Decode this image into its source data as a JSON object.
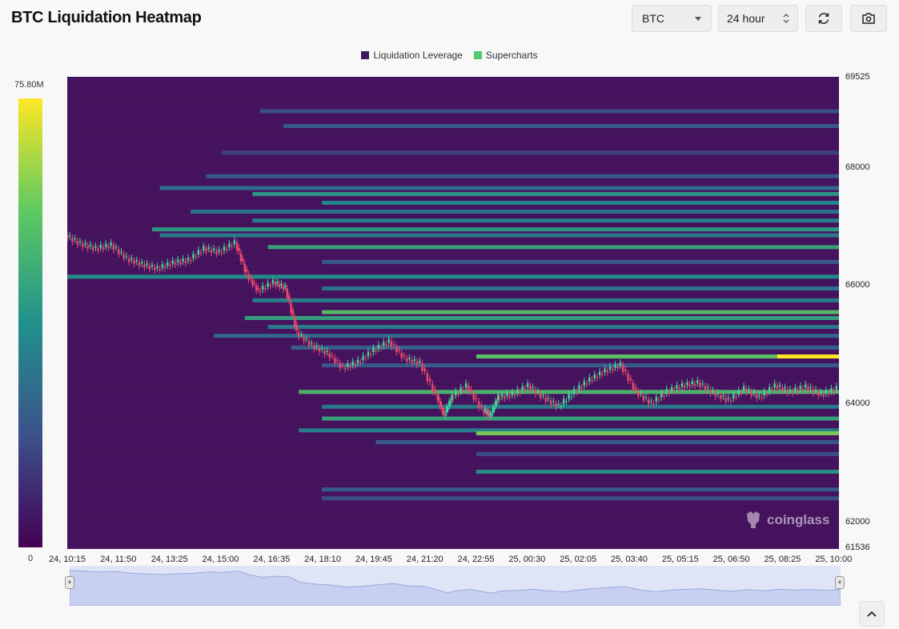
{
  "header": {
    "title": "BTC Liquidation Heatmap",
    "symbol": "BTC",
    "timeframe": "24 hour",
    "refresh_icon": "refresh-icon",
    "camera_icon": "camera-icon"
  },
  "legend": [
    {
      "label": "Liquidation Leverage",
      "color": "#3b1a5e"
    },
    {
      "label": "Supercharts",
      "color": "#4ecb71"
    }
  ],
  "colorbar": {
    "max_label": "75.80M",
    "min_label": "0"
  },
  "watermark": "coinglass",
  "chart_data": {
    "type": "heatmap",
    "title": "BTC Liquidation Heatmap",
    "ylim": [
      61536,
      69525
    ],
    "yticks": [
      "69525",
      "68000",
      "66000",
      "64000",
      "62000",
      "61536"
    ],
    "yticks_values": [
      69525,
      68000,
      66000,
      64000,
      62000,
      61536
    ],
    "xticks": [
      "24, 10:15",
      "24, 11:50",
      "24, 13:25",
      "24, 15:00",
      "24, 16:35",
      "24, 18:10",
      "24, 19:45",
      "24, 21:20",
      "24, 22:55",
      "25, 00:30",
      "25, 02:05",
      "25, 03:40",
      "25, 05:15",
      "25, 06:50",
      "25, 08:25",
      "25, 10:00"
    ],
    "colorscale": {
      "min": 0,
      "max": 75800000,
      "max_label": "75.80M"
    },
    "bands": [
      {
        "price": 68950,
        "start": 0.25,
        "value": 0.25
      },
      {
        "price": 68700,
        "start": 0.28,
        "value": 0.3
      },
      {
        "price": 68250,
        "start": 0.2,
        "value": 0.2
      },
      {
        "price": 67850,
        "start": 0.18,
        "value": 0.3
      },
      {
        "price": 67650,
        "start": 0.12,
        "value": 0.38
      },
      {
        "price": 67550,
        "start": 0.24,
        "value": 0.55
      },
      {
        "price": 67400,
        "start": 0.33,
        "value": 0.48
      },
      {
        "price": 67250,
        "start": 0.16,
        "value": 0.4
      },
      {
        "price": 67100,
        "start": 0.24,
        "value": 0.45
      },
      {
        "price": 66950,
        "start": 0.11,
        "value": 0.55
      },
      {
        "price": 66850,
        "start": 0.12,
        "value": 0.42
      },
      {
        "price": 66650,
        "start": 0.26,
        "value": 0.6
      },
      {
        "price": 66400,
        "start": 0.33,
        "value": 0.3
      },
      {
        "price": 66150,
        "start": 0.0,
        "value": 0.5
      },
      {
        "price": 65950,
        "start": 0.33,
        "value": 0.4
      },
      {
        "price": 65750,
        "start": 0.24,
        "value": 0.45
      },
      {
        "price": 65550,
        "start": 0.33,
        "value": 0.72
      },
      {
        "price": 65450,
        "start": 0.23,
        "value": 0.58
      },
      {
        "price": 65300,
        "start": 0.26,
        "value": 0.42
      },
      {
        "price": 65150,
        "start": 0.19,
        "value": 0.35
      },
      {
        "price": 64950,
        "start": 0.29,
        "value": 0.32
      },
      {
        "price": 64800,
        "start": 0.53,
        "value": 0.75,
        "hot_from": 0.92
      },
      {
        "price": 64650,
        "start": 0.33,
        "value": 0.3
      },
      {
        "price": 64200,
        "start": 0.3,
        "value": 0.68
      },
      {
        "price": 63950,
        "start": 0.33,
        "value": 0.42
      },
      {
        "price": 63750,
        "start": 0.33,
        "value": 0.6
      },
      {
        "price": 63550,
        "start": 0.3,
        "value": 0.45
      },
      {
        "price": 63500,
        "start": 0.53,
        "value": 0.8
      },
      {
        "price": 63350,
        "start": 0.4,
        "value": 0.3
      },
      {
        "price": 63150,
        "start": 0.53,
        "value": 0.25
      },
      {
        "price": 62850,
        "start": 0.53,
        "value": 0.52
      },
      {
        "price": 62550,
        "start": 0.33,
        "value": 0.3
      },
      {
        "price": 62400,
        "start": 0.33,
        "value": 0.25
      }
    ],
    "price_series": [
      [
        0,
        66850
      ],
      [
        0.02,
        66700
      ],
      [
        0.04,
        66620
      ],
      [
        0.06,
        66680
      ],
      [
        0.08,
        66450
      ],
      [
        0.1,
        66350
      ],
      [
        0.12,
        66280
      ],
      [
        0.14,
        66380
      ],
      [
        0.16,
        66420
      ],
      [
        0.18,
        66620
      ],
      [
        0.2,
        66560
      ],
      [
        0.22,
        66720
      ],
      [
        0.235,
        66180
      ],
      [
        0.25,
        65900
      ],
      [
        0.27,
        66050
      ],
      [
        0.285,
        65950
      ],
      [
        0.3,
        65200
      ],
      [
        0.32,
        64980
      ],
      [
        0.34,
        64850
      ],
      [
        0.36,
        64600
      ],
      [
        0.38,
        64700
      ],
      [
        0.4,
        64900
      ],
      [
        0.42,
        65050
      ],
      [
        0.44,
        64760
      ],
      [
        0.46,
        64680
      ],
      [
        0.48,
        64150
      ],
      [
        0.49,
        63800
      ],
      [
        0.5,
        64100
      ],
      [
        0.52,
        64300
      ],
      [
        0.54,
        63900
      ],
      [
        0.55,
        63800
      ],
      [
        0.56,
        64100
      ],
      [
        0.58,
        64150
      ],
      [
        0.6,
        64300
      ],
      [
        0.62,
        64100
      ],
      [
        0.64,
        63950
      ],
      [
        0.66,
        64200
      ],
      [
        0.68,
        64400
      ],
      [
        0.7,
        64550
      ],
      [
        0.72,
        64650
      ],
      [
        0.74,
        64200
      ],
      [
        0.76,
        64000
      ],
      [
        0.78,
        64200
      ],
      [
        0.8,
        64300
      ],
      [
        0.82,
        64350
      ],
      [
        0.84,
        64180
      ],
      [
        0.86,
        64050
      ],
      [
        0.88,
        64250
      ],
      [
        0.9,
        64100
      ],
      [
        0.92,
        64300
      ],
      [
        0.94,
        64200
      ],
      [
        0.96,
        64280
      ],
      [
        0.98,
        64150
      ],
      [
        1.0,
        64250
      ]
    ],
    "grid": false,
    "legend_position": "top-center"
  }
}
